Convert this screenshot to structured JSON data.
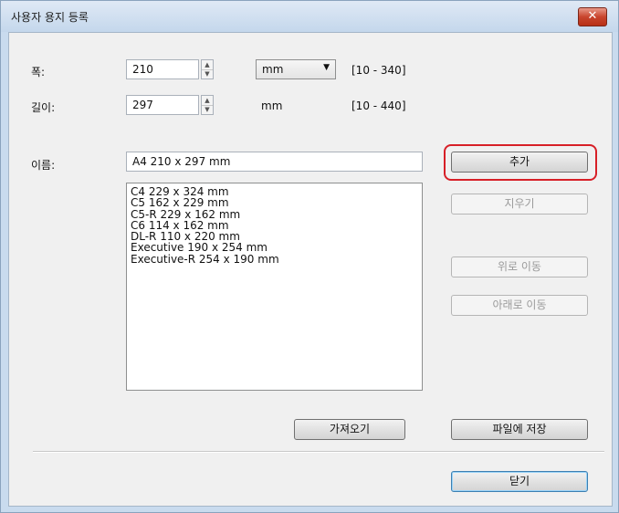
{
  "window": {
    "title": "사용자 용지 등록",
    "close_symbol": "✕"
  },
  "width": {
    "label": "폭:",
    "value": "210",
    "unit": "mm",
    "range": "[10 - 340]"
  },
  "length": {
    "label": "길이:",
    "value": "297",
    "unit": "mm",
    "range": "[10 - 440]"
  },
  "name": {
    "label": "이름:",
    "value": "A4 210 x 297 mm"
  },
  "paper_list": [
    "C4 229 x 324 mm",
    "C5 162 x 229 mm",
    "C5-R 229 x 162 mm",
    "C6 114 x 162 mm",
    "DL-R 110 x 220 mm",
    "Executive 190 x 254 mm",
    "Executive-R 254 x 190 mm"
  ],
  "buttons": {
    "add": "추가",
    "delete": "지우기",
    "move_up": "위로 이동",
    "move_down": "아래로 이동",
    "import": "가져오기",
    "save_to_file": "파일에 저장",
    "close": "닫기"
  },
  "spin_glyphs": {
    "up": "▲",
    "down": "▼"
  },
  "colors": {
    "highlight": "#d71f27",
    "title_bar": "#c4d7ec",
    "close_button": "#c8442d"
  }
}
